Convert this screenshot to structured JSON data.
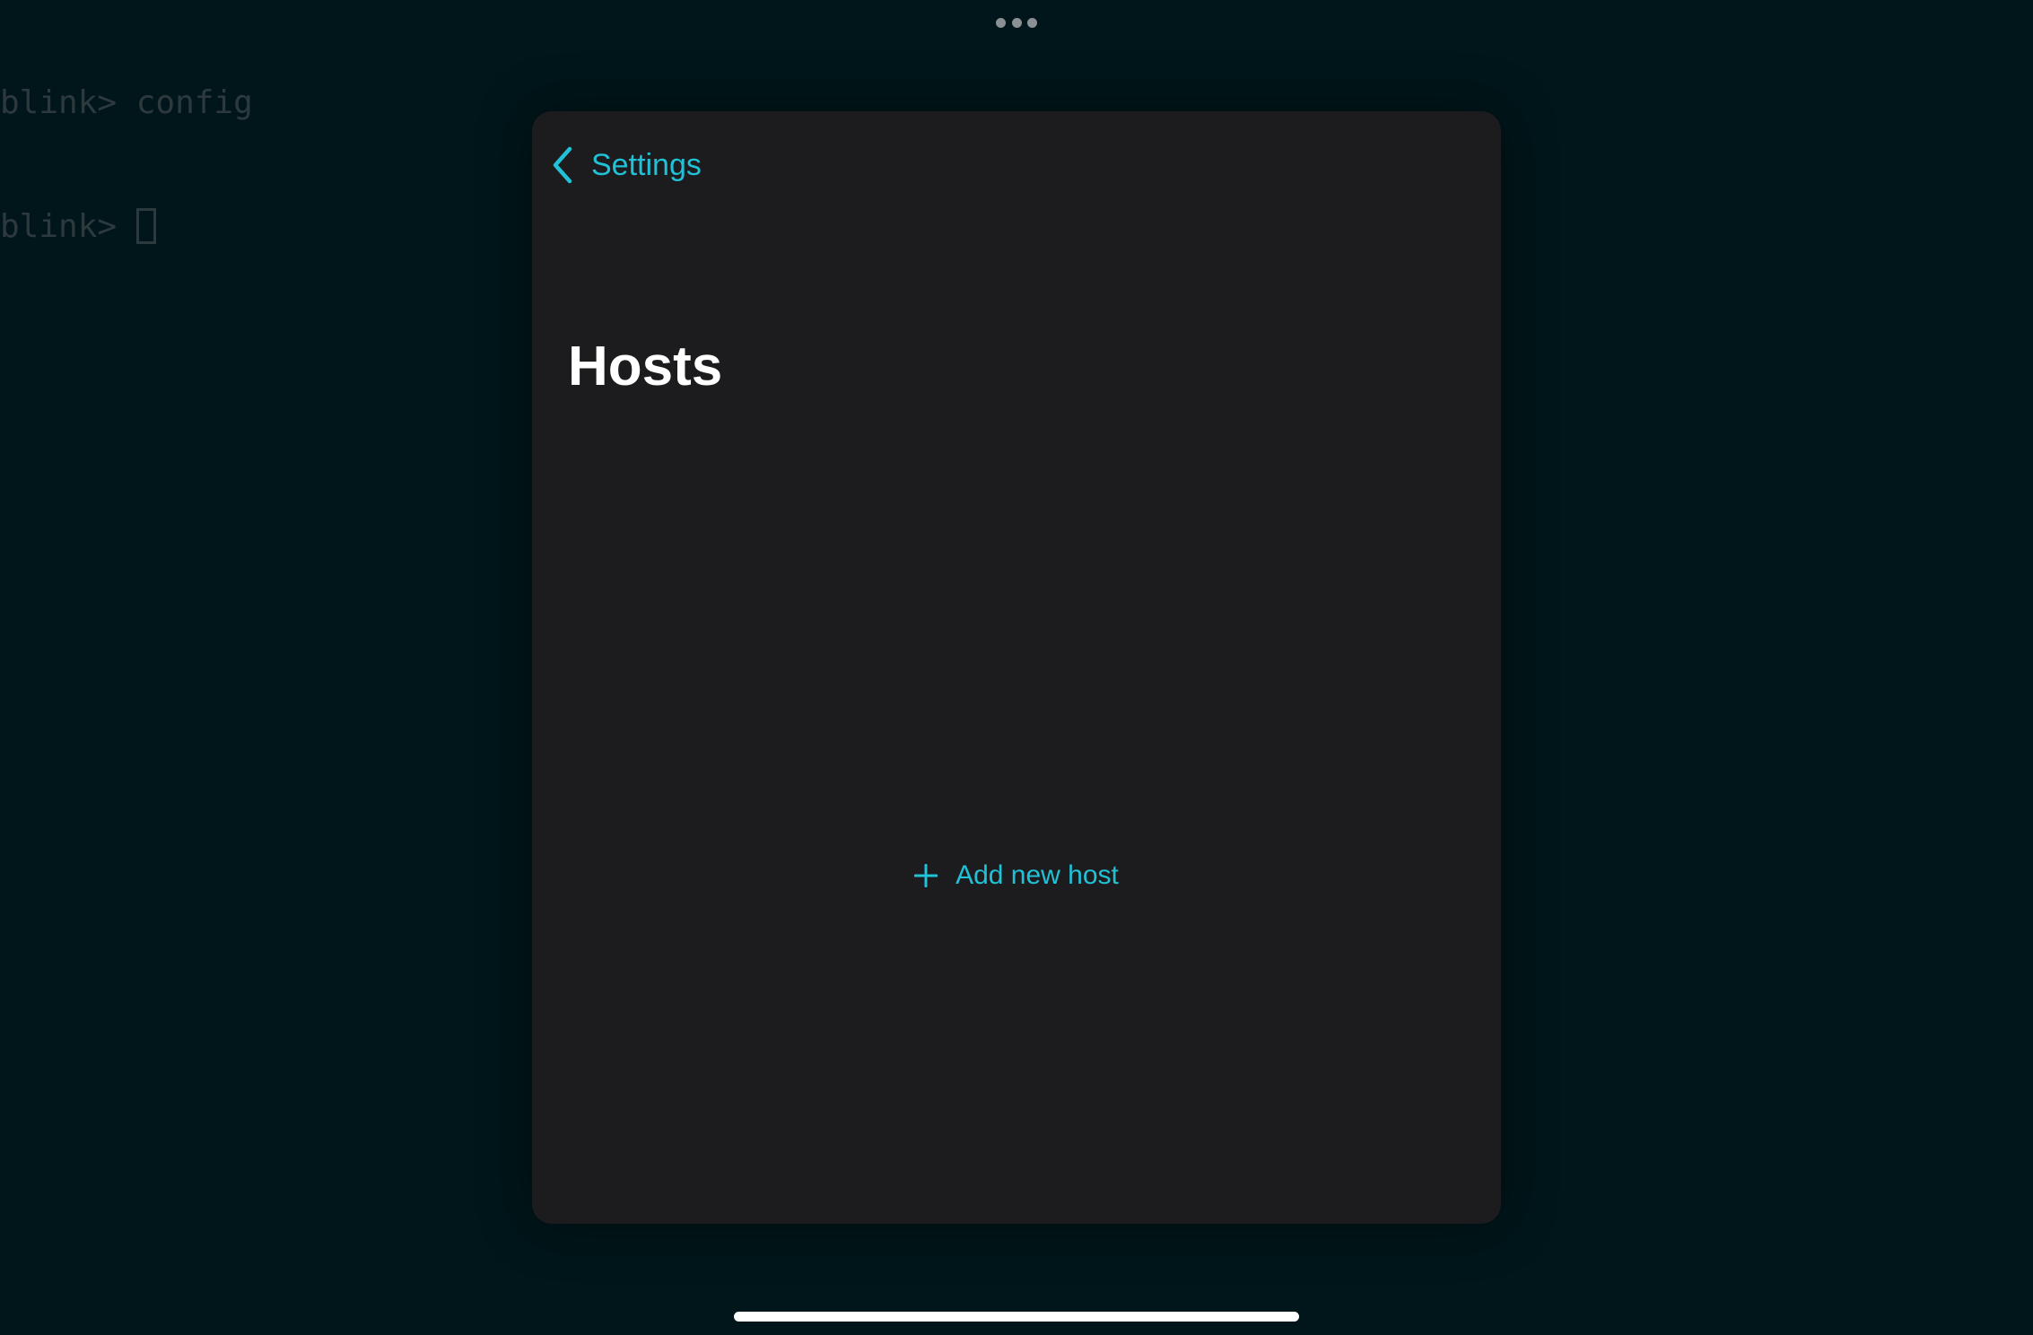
{
  "terminal": {
    "lines": [
      {
        "prompt": "blink> ",
        "command": "config"
      },
      {
        "prompt": "blink> ",
        "command": ""
      }
    ]
  },
  "multitask": {
    "icon": "ellipsis-icon"
  },
  "sheet": {
    "back_label": "Settings",
    "back_icon": "chevron-left-icon",
    "title": "Hosts",
    "add_host_label": "Add new host",
    "add_host_icon": "plus-icon"
  },
  "colors": {
    "accent": "#21c1d6",
    "sheet_background": "#1c1c1e",
    "terminal_background": "#01161a",
    "terminal_text": "#2d3a3d"
  }
}
